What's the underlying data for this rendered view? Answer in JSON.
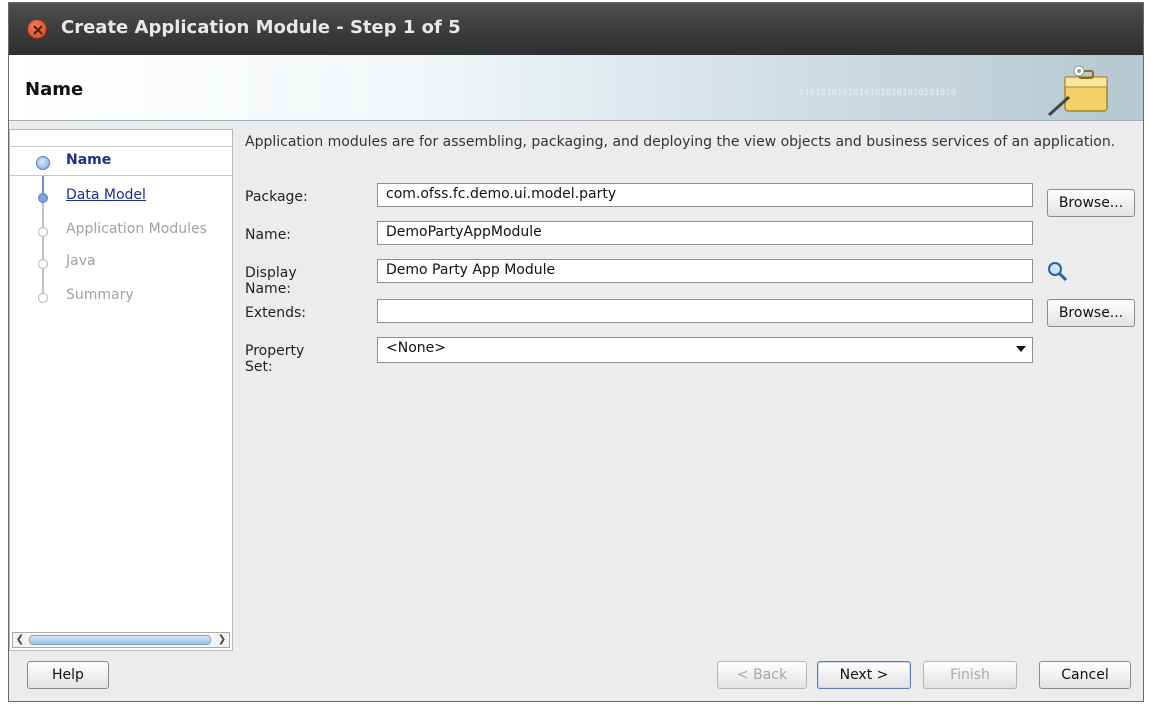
{
  "window": {
    "title": "Create Application Module - Step 1 of 5"
  },
  "header": {
    "title": "Name",
    "binary_text": "01010101010101010101010101010"
  },
  "steps": [
    {
      "label": "Name",
      "state": "active"
    },
    {
      "label": "Data Model",
      "state": "link"
    },
    {
      "label": "Application Modules",
      "state": "disabled"
    },
    {
      "label": "Java",
      "state": "disabled"
    },
    {
      "label": "Summary",
      "state": "disabled"
    }
  ],
  "description": "Application modules are for assembling, packaging, and deploying the view objects and business services of an application.",
  "form": {
    "package_label": "Package:",
    "package_value": "com.ofss.fc.demo.ui.model.party",
    "name_label": "Name:",
    "name_value": "DemoPartyAppModule",
    "display_name_label": "Display Name:",
    "display_name_value": "Demo Party App Module",
    "extends_label": "Extends:",
    "extends_value": "",
    "property_set_label": "Property Set:",
    "property_set_value": "<None>",
    "browse_label": "Browse..."
  },
  "buttons": {
    "help": "Help",
    "back": "< Back",
    "next": "Next >",
    "finish": "Finish",
    "cancel": "Cancel"
  },
  "colors": {
    "title_bar": "#3a3a3a",
    "link": "#1e2e8c",
    "close_button": "#d04a25"
  },
  "icons": [
    "close-icon",
    "briefcase-icon",
    "search-icon",
    "left-arrow-icon",
    "right-arrow-icon",
    "chevron-down-icon"
  ]
}
